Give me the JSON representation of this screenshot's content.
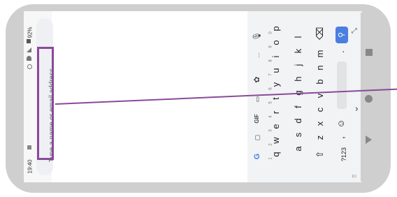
{
  "status": {
    "time": "19:40",
    "battery": "92%"
  },
  "compose": {
    "back_glyph": "↓",
    "placeholder": "Type a name or email address"
  },
  "keyboard": {
    "rows": [
      [
        "q",
        "w",
        "e",
        "r",
        "t",
        "y",
        "u",
        "i",
        "o",
        "p"
      ],
      [
        "a",
        "s",
        "d",
        "f",
        "g",
        "h",
        "j",
        "k",
        "l"
      ],
      [
        "z",
        "x",
        "c",
        "v",
        "b",
        "n",
        "m"
      ]
    ],
    "numbers": [
      "1",
      "2",
      "3",
      "4",
      "5",
      "6",
      "7",
      "8",
      "9",
      "0"
    ],
    "toolbar": [
      "G",
      "sticker",
      "GIF",
      "clipboard",
      "settings",
      "...",
      "mic"
    ],
    "toolbar_gif": "GIF",
    "shift": "⇧",
    "backspace": "⌫",
    "symbols": "?123",
    "comma": ",",
    "emoji": "☺",
    "period": ".",
    "search": "⚲",
    "collapse": "⌄",
    "resize": "⤡"
  },
  "navbar": {
    "back": "◀",
    "home": "●",
    "recents": "■"
  },
  "colors": {
    "highlight": "#8a4a9a",
    "accent": "#4a7ee0"
  }
}
